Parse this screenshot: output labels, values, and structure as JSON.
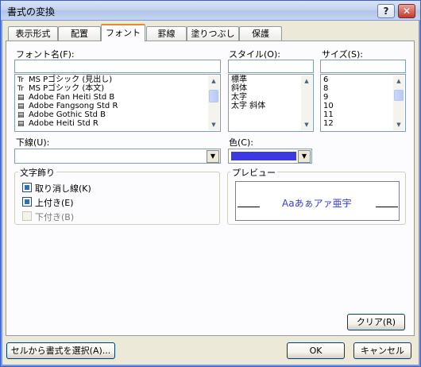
{
  "window": {
    "title": "書式の変換",
    "help_glyph": "?",
    "close_glyph": "✕"
  },
  "tabs": [
    {
      "label": "表示形式",
      "active": false
    },
    {
      "label": "配置",
      "active": false
    },
    {
      "label": "フォント",
      "active": true
    },
    {
      "label": "罫線",
      "active": false
    },
    {
      "label": "塗りつぶし",
      "active": false
    },
    {
      "label": "保護",
      "active": false
    }
  ],
  "font": {
    "label": "フォント名(F):",
    "value": "",
    "items": [
      {
        "icon": "truetype-font-icon",
        "glyph": "Tr",
        "name": "MS Pゴシック (見出し)"
      },
      {
        "icon": "truetype-font-icon",
        "glyph": "Tr",
        "name": "MS Pゴシック (本文)"
      },
      {
        "icon": "opentype-font-icon",
        "glyph": "▤",
        "name": "Adobe Fan Heiti Std B"
      },
      {
        "icon": "opentype-font-icon",
        "glyph": "▤",
        "name": "Adobe Fangsong Std R"
      },
      {
        "icon": "opentype-font-icon",
        "glyph": "▤",
        "name": "Adobe Gothic Std B"
      },
      {
        "icon": "opentype-font-icon",
        "glyph": "▤",
        "name": "Adobe Heiti Std R"
      }
    ]
  },
  "style": {
    "label": "スタイル(O):",
    "value": "",
    "items": [
      "標準",
      "斜体",
      "太字",
      "太字 斜体"
    ]
  },
  "size": {
    "label": "サイズ(S):",
    "value": "",
    "items": [
      "6",
      "8",
      "9",
      "10",
      "11",
      "12"
    ]
  },
  "underline": {
    "label": "下線(U):",
    "value": ""
  },
  "color": {
    "label": "色(C):",
    "swatch": "#3a3ae0"
  },
  "effects": {
    "title": "文字飾り",
    "items": [
      {
        "label": "取り消し線(K)",
        "checked": true,
        "disabled": false
      },
      {
        "label": "上付き(E)",
        "checked": true,
        "disabled": false
      },
      {
        "label": "下付き(B)",
        "checked": false,
        "disabled": true
      }
    ]
  },
  "preview": {
    "title": "プレビュー",
    "sample": "Aaあぁアァ亜宇",
    "sample_color": "#3a3ae0"
  },
  "buttons": {
    "clear": "クリア(R)",
    "pick_from_cell": "セルから書式を選択(A)...",
    "ok": "OK",
    "cancel": "キャンセル"
  },
  "glyphs": {
    "arrow_up": "▲",
    "arrow_down": "▼"
  }
}
